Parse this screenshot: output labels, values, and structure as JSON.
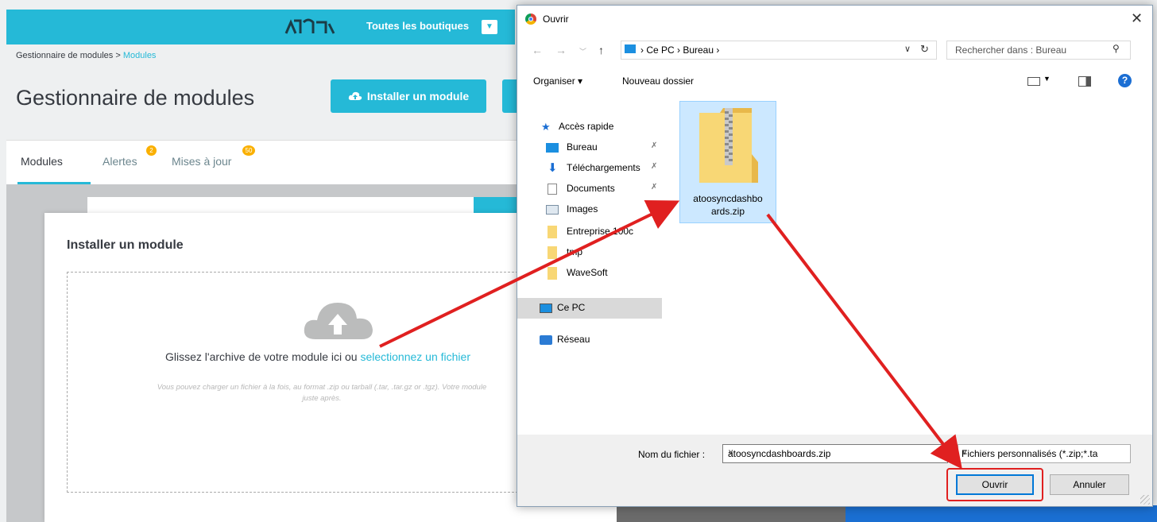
{
  "admin": {
    "shops_label": "Toutes les boutiques",
    "breadcrumb_root": "Gestionnaire de modules",
    "breadcrumb_sep": ">",
    "breadcrumb_current": "Modules",
    "page_title": "Gestionnaire de modules",
    "install_button": "Installer un module",
    "tabs": [
      {
        "label": "Modules",
        "badge": ""
      },
      {
        "label": "Alertes",
        "badge": "2"
      },
      {
        "label": "Mises à jour",
        "badge": "50"
      }
    ],
    "accent_color": "#25b9d7"
  },
  "modal": {
    "title": "Installer un module",
    "drop_text": "Glissez l'archive de votre module ici ou ",
    "drop_link": "selectionnez un fichier",
    "hint_line1": "Vous pouvez charger un fichier à la fois, au format .zip ou tarball (.tar, .tar.gz or .tgz). Votre module",
    "hint_line2": "juste après."
  },
  "dialog": {
    "title": "Ouvrir",
    "address": "› Ce PC  ›  Bureau  ›",
    "search_placeholder": "Rechercher dans : Bureau",
    "organize": "Organiser ▾",
    "new_folder": "Nouveau dossier",
    "sidebar": [
      {
        "label": "Accès rapide",
        "icon": "star-icon",
        "pinned": false
      },
      {
        "label": "Bureau",
        "icon": "desktop-folder-icon",
        "pinned": true
      },
      {
        "label": "Téléchargements",
        "icon": "download-icon",
        "pinned": true
      },
      {
        "label": "Documents",
        "icon": "documents-icon",
        "pinned": true
      },
      {
        "label": "Images",
        "icon": "images-icon",
        "pinned": true
      },
      {
        "label": "Entreprise 100c",
        "icon": "folder-icon",
        "pinned": false
      },
      {
        "label": "tmp",
        "icon": "folder-icon",
        "pinned": false
      },
      {
        "label": "WaveSoft",
        "icon": "folder-icon",
        "pinned": false
      },
      {
        "label": "Ce PC",
        "icon": "computer-icon",
        "pinned": false
      },
      {
        "label": "Réseau",
        "icon": "network-icon",
        "pinned": false
      }
    ],
    "file_name_line1": "atoosyncdashbo",
    "file_name_line2": "ards.zip",
    "filename_label": "Nom du fichier :",
    "filename_value": "atoosyncdashboards.zip",
    "filter_value": "Fichiers personnalisés (*.zip;*.ta",
    "open_button": "Ouvrir",
    "cancel_button": "Annuler",
    "highlight_color": "#e02020"
  }
}
